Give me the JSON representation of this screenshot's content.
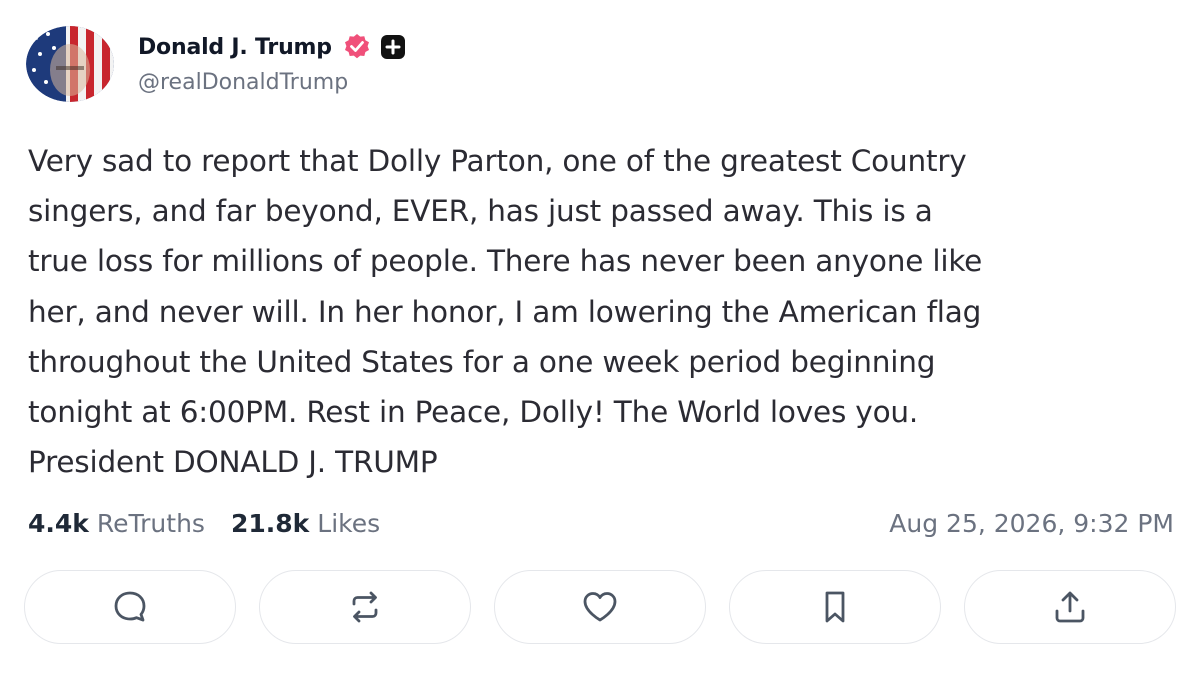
{
  "author": {
    "display_name": "Donald J. Trump",
    "handle": "@realDonaldTrump",
    "avatar_icon": "flag-portrait-avatar",
    "verified_icon": "verified-badge-icon",
    "badge_icon": "plus-badge-icon"
  },
  "post": {
    "text": "Very sad to report that Dolly Parton, one of the greatest Country\nsingers, and far beyond, EVER, has just passed away. This is a\ntrue loss for millions of people. There has never been anyone like\nher, and never will. In her honor, I am lowering the American flag\nthroughout the United States for a one week period beginning\ntonight at 6:00PM. Rest in Peace, Dolly! The World loves you.\nPresident DONALD J. TRUMP"
  },
  "stats": {
    "retruths_count": "4.4k",
    "retruths_label": "ReTruths",
    "likes_count": "21.8k",
    "likes_label": "Likes",
    "timestamp": "Aug 25, 2026, 9:32 PM"
  },
  "actions": [
    {
      "icon": "reply-icon"
    },
    {
      "icon": "retruth-icon"
    },
    {
      "icon": "like-heart-icon"
    },
    {
      "icon": "bookmark-icon"
    },
    {
      "icon": "share-icon"
    }
  ],
  "colors": {
    "verified": "#f0507a",
    "text": "#2b2b33",
    "muted": "#6b7280",
    "border": "#e5e7eb"
  }
}
